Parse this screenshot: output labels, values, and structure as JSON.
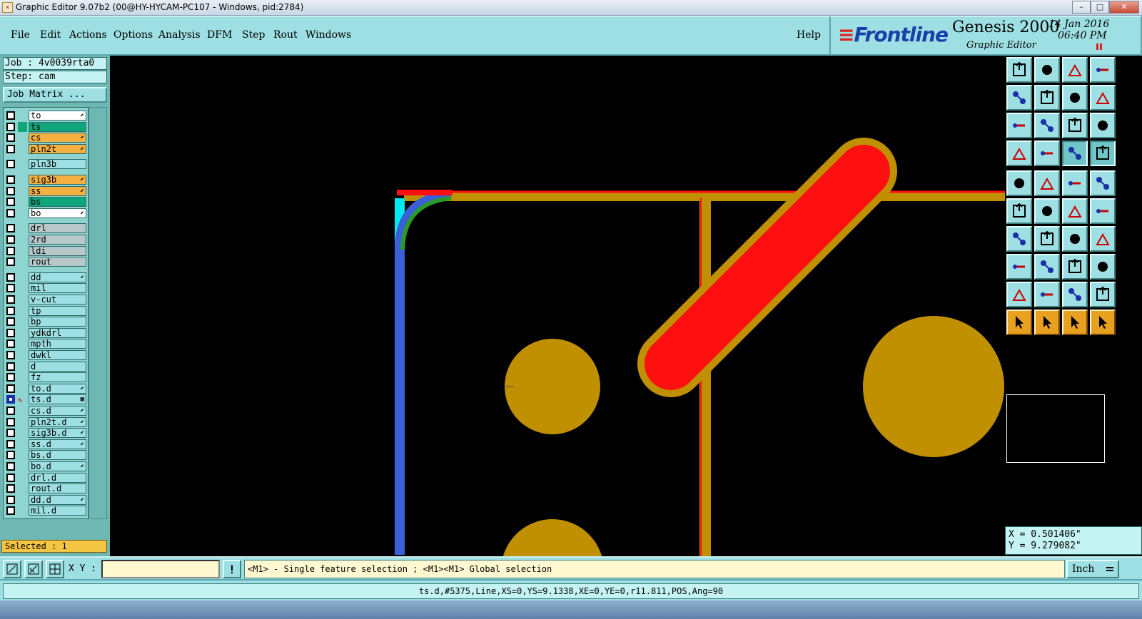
{
  "window": {
    "title": "Graphic Editor 9.07b2 (00@HY-HYCAM-PC107 - Windows, pid:2784)",
    "controls": [
      "–",
      "□",
      "✕"
    ]
  },
  "menu": {
    "items": [
      "File",
      "Edit",
      "Actions",
      "Options",
      "Analysis",
      "DFM",
      "Step",
      "Rout",
      "Windows"
    ],
    "help": "Help"
  },
  "brand": {
    "logo": "Frontline",
    "product": "Genesis 2000",
    "subtitle": "Graphic Editor",
    "date": "14 Jan 2016",
    "time": "06:40 PM"
  },
  "job": {
    "job_line": "Job : 4v0039rta0",
    "step_line": "Step: cam",
    "matrix_button": "Job Matrix ..."
  },
  "layers": [
    {
      "name": "to",
      "color": "#ffffff",
      "mark": "⬋",
      "group": 0
    },
    {
      "name": "ts",
      "color": "#0fa67a",
      "mark": "",
      "group": 0,
      "sub": "#0fa67a"
    },
    {
      "name": "cs",
      "color": "#f5b042",
      "mark": "⬋",
      "group": 0
    },
    {
      "name": "pln2t",
      "color": "#f5b042",
      "mark": "⬋",
      "group": 0
    },
    {
      "name": "pln3b",
      "color": "#9ddfe2",
      "mark": "",
      "group": 1
    },
    {
      "name": "sig3b",
      "color": "#f5b042",
      "mark": "⬋",
      "group": 2
    },
    {
      "name": "ss",
      "color": "#f5b042",
      "mark": "⬋",
      "group": 2
    },
    {
      "name": "bs",
      "color": "#0fa67a",
      "mark": "",
      "group": 2
    },
    {
      "name": "bo",
      "color": "#ffffff",
      "mark": "⬋",
      "group": 2
    },
    {
      "name": "drl",
      "color": "#b8c8c8",
      "mark": "",
      "group": 3
    },
    {
      "name": "2rd",
      "color": "#b8c8c8",
      "mark": "",
      "group": 3
    },
    {
      "name": "ldi",
      "color": "#b8c8c8",
      "mark": "",
      "group": 3
    },
    {
      "name": "rout",
      "color": "#b8c8c8",
      "mark": "",
      "group": 3
    },
    {
      "name": "dd",
      "color": "#9ddfe2",
      "mark": "⬋",
      "group": 4
    },
    {
      "name": "mil",
      "color": "#9ddfe2",
      "mark": "",
      "group": 4
    },
    {
      "name": "v-cut",
      "color": "#9ddfe2",
      "mark": "",
      "group": 4
    },
    {
      "name": "tp",
      "color": "#9ddfe2",
      "mark": "",
      "group": 4
    },
    {
      "name": "bp",
      "color": "#9ddfe2",
      "mark": "",
      "group": 4
    },
    {
      "name": "ydkdrl",
      "color": "#9ddfe2",
      "mark": "",
      "group": 4
    },
    {
      "name": "mpth",
      "color": "#9ddfe2",
      "mark": "",
      "group": 4
    },
    {
      "name": "dwkl",
      "color": "#9ddfe2",
      "mark": "",
      "group": 4
    },
    {
      "name": "d",
      "color": "#9ddfe2",
      "mark": "",
      "group": 4
    },
    {
      "name": "fz",
      "color": "#9ddfe2",
      "mark": "",
      "group": 4
    },
    {
      "name": "to.d",
      "color": "#9ddfe2",
      "mark": "⬋",
      "group": 4
    },
    {
      "name": "ts.d",
      "color": "#9ddfe2",
      "mark": "▦",
      "group": 4,
      "active": true
    },
    {
      "name": "cs.d",
      "color": "#9ddfe2",
      "mark": "⬋",
      "group": 4
    },
    {
      "name": "pln2t.d",
      "color": "#9ddfe2",
      "mark": "⬋",
      "group": 4
    },
    {
      "name": "sig3b.d",
      "color": "#9ddfe2",
      "mark": "⬋",
      "group": 4
    },
    {
      "name": "ss.d",
      "color": "#9ddfe2",
      "mark": "⬋",
      "group": 4
    },
    {
      "name": "bs.d",
      "color": "#9ddfe2",
      "mark": "",
      "group": 4
    },
    {
      "name": "bo.d",
      "color": "#9ddfe2",
      "mark": "⬋",
      "group": 4
    },
    {
      "name": "drl.d",
      "color": "#9ddfe2",
      "mark": "",
      "group": 4
    },
    {
      "name": "rout.d",
      "color": "#9ddfe2",
      "mark": "",
      "group": 4
    },
    {
      "name": "dd.d",
      "color": "#9ddfe2",
      "mark": "⬋",
      "group": 4
    },
    {
      "name": "mil.d",
      "color": "#9ddfe2",
      "mark": "",
      "group": 4
    }
  ],
  "selected_text": "Selected : 1",
  "toolbar_icons": [
    "zoom-up-icon",
    "zoom-down-icon",
    "home-icon",
    "split-view-icon",
    "pan-left-icon",
    "pan-right-icon",
    "undo-view-icon",
    "redraw-icon",
    "fit-all-icon",
    "zoom-center-icon",
    "one-to-two-icon",
    "help-icon",
    "snap-icon",
    "measure-pin-icon",
    "layer-compare-icon",
    "layer-toggle-icon",
    "pad-icon",
    "transform-icon",
    "ruler-icon",
    "round-pad-icon",
    "connect-icon",
    "cross-icon",
    "line-node-icon",
    "arc-node-icon",
    "add-line-icon",
    "move-line-icon",
    "rotate-icon",
    "mirror-text-icon",
    "move-pad-icon",
    "dash-line-icon",
    "dimension-icon",
    "copy-pad-icon",
    "polygon-up-icon",
    "polygon-a-icon",
    "polygon-b-icon",
    "polygon-c-icon",
    "select-arrow-icon",
    "select-box-icon",
    "select-touch-icon",
    "select-net-icon"
  ],
  "coords": {
    "x": "X = 0.501406\"",
    "y": "Y = 9.279082\""
  },
  "command": {
    "xy_label": "X Y :",
    "xy_value": "",
    "warning": "!",
    "hint": "<M1> - Single feature selection ; <M1><M1> Global selection",
    "units": "Inch"
  },
  "status": "ts.d,#5375,Line,XS=0,YS=9.1338,XE=0,YE=0,r11.811,POS,Ang=90",
  "colors": {
    "panel": "#9ddfe2",
    "trace_gold": "#c09000",
    "feature_red": "#ff1010",
    "selected_blue": "#3a5fd8",
    "highlight_cyan": "#00e8f0"
  }
}
